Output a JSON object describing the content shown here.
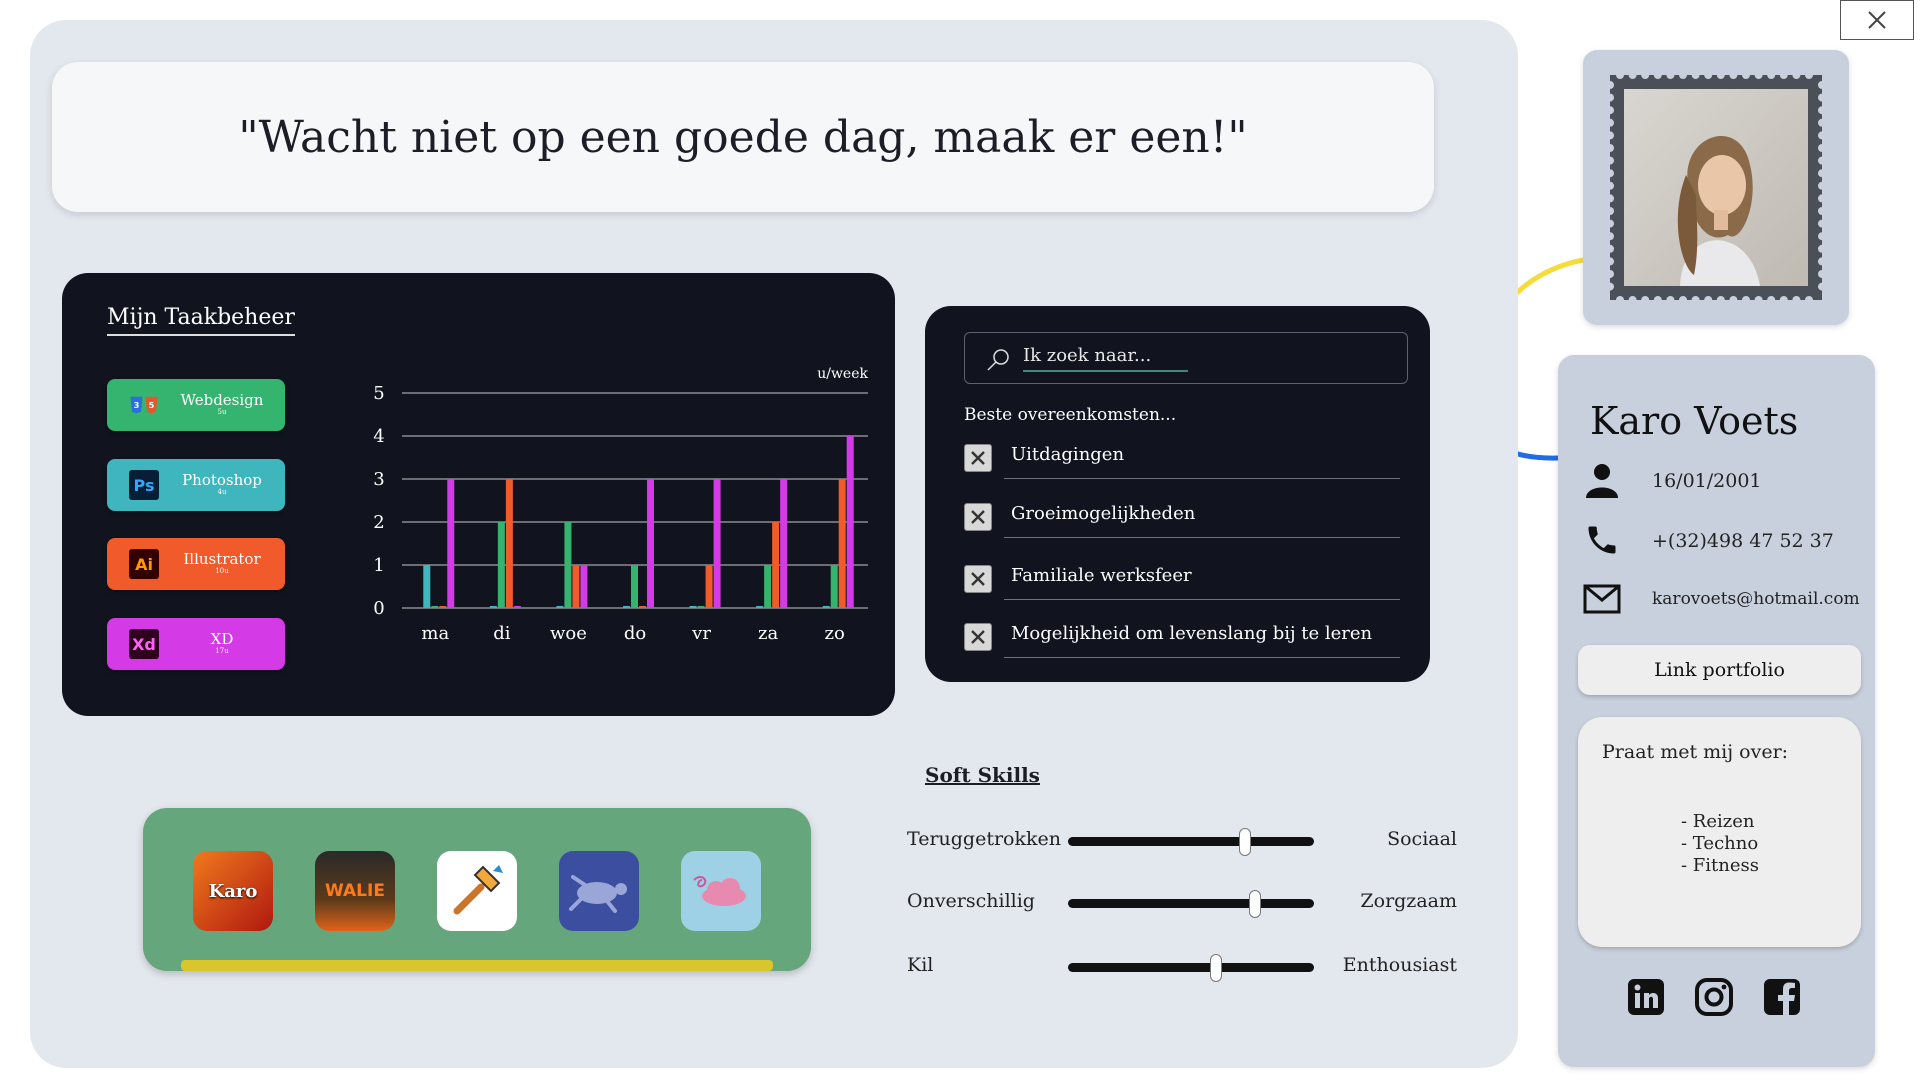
{
  "quote": "\"Wacht niet op een goede dag, maak er een!\"",
  "close_icon": "close-icon",
  "task_manager": {
    "title": "Mijn Taakbeheer",
    "skills": [
      {
        "name": "Webdesign",
        "sub": "5u",
        "color": "#35b46f",
        "icon": "css-html-icon"
      },
      {
        "name": "Photoshop",
        "sub": "4u",
        "color": "#3fb5bd",
        "icon": "photoshop-icon"
      },
      {
        "name": "Illustrator",
        "sub": "10u",
        "color": "#f15a2b",
        "icon": "illustrator-icon"
      },
      {
        "name": "XD",
        "sub": "17u",
        "color": "#d43be6",
        "icon": "xd-icon"
      }
    ]
  },
  "chart_data": {
    "type": "bar",
    "unit_label": "u/week",
    "categories": [
      "ma",
      "di",
      "woe",
      "do",
      "vr",
      "za",
      "zo"
    ],
    "ylim": [
      0,
      5
    ],
    "yticks": [
      0,
      1,
      2,
      3,
      4,
      5
    ],
    "grid": true,
    "series": [
      {
        "color": "#3fb5bd",
        "values": [
          1,
          0,
          0,
          0,
          0,
          0,
          0
        ]
      },
      {
        "color": "#35b46f",
        "values": [
          0,
          2,
          2,
          1,
          0,
          1,
          1
        ]
      },
      {
        "color": "#f15a2b",
        "values": [
          0,
          3,
          1,
          0,
          1,
          2,
          3
        ]
      },
      {
        "color": "#d43be6",
        "values": [
          3,
          0,
          1,
          3,
          3,
          3,
          4
        ]
      }
    ]
  },
  "search": {
    "placeholder": "Ik zoek naar...",
    "matches_label": "Beste overeenkomsten...",
    "matches": [
      "Uitdagingen",
      "Groeimogelijkheden",
      "Familiale werksfeer",
      "Mogelijkheid om levenslang bij te leren"
    ]
  },
  "apps": [
    {
      "name": "Karo",
      "icon": "karo-app-icon"
    },
    {
      "name": "WALIE",
      "icon": "halloween-game-icon"
    },
    {
      "name": "",
      "icon": "hammer-icon"
    },
    {
      "name": "",
      "icon": "turtle-icon"
    },
    {
      "name": "",
      "icon": "cloud-icon"
    }
  ],
  "soft_skills": {
    "title": "Soft Skills",
    "sliders": [
      {
        "left": "Teruggetrokken",
        "right": "Sociaal",
        "level": 0.72
      },
      {
        "left": "Onverschillig",
        "right": "Zorgzaam",
        "level": 0.76
      },
      {
        "left": "Kil",
        "right": "Enthousiast",
        "level": 0.6
      }
    ]
  },
  "profile": {
    "name": "Karo Voets",
    "birthdate": "16/01/2001",
    "phone": "+(32)498 47 52 37",
    "email": "karovoets@hotmail.com",
    "portfolio_label": "Link portfolio",
    "talk_title": "Praat met mij over:",
    "talk_items": [
      "- Reizen",
      "- Techno",
      "- Fitness"
    ],
    "socials": [
      "linkedin-icon",
      "instagram-icon",
      "facebook-icon"
    ]
  }
}
